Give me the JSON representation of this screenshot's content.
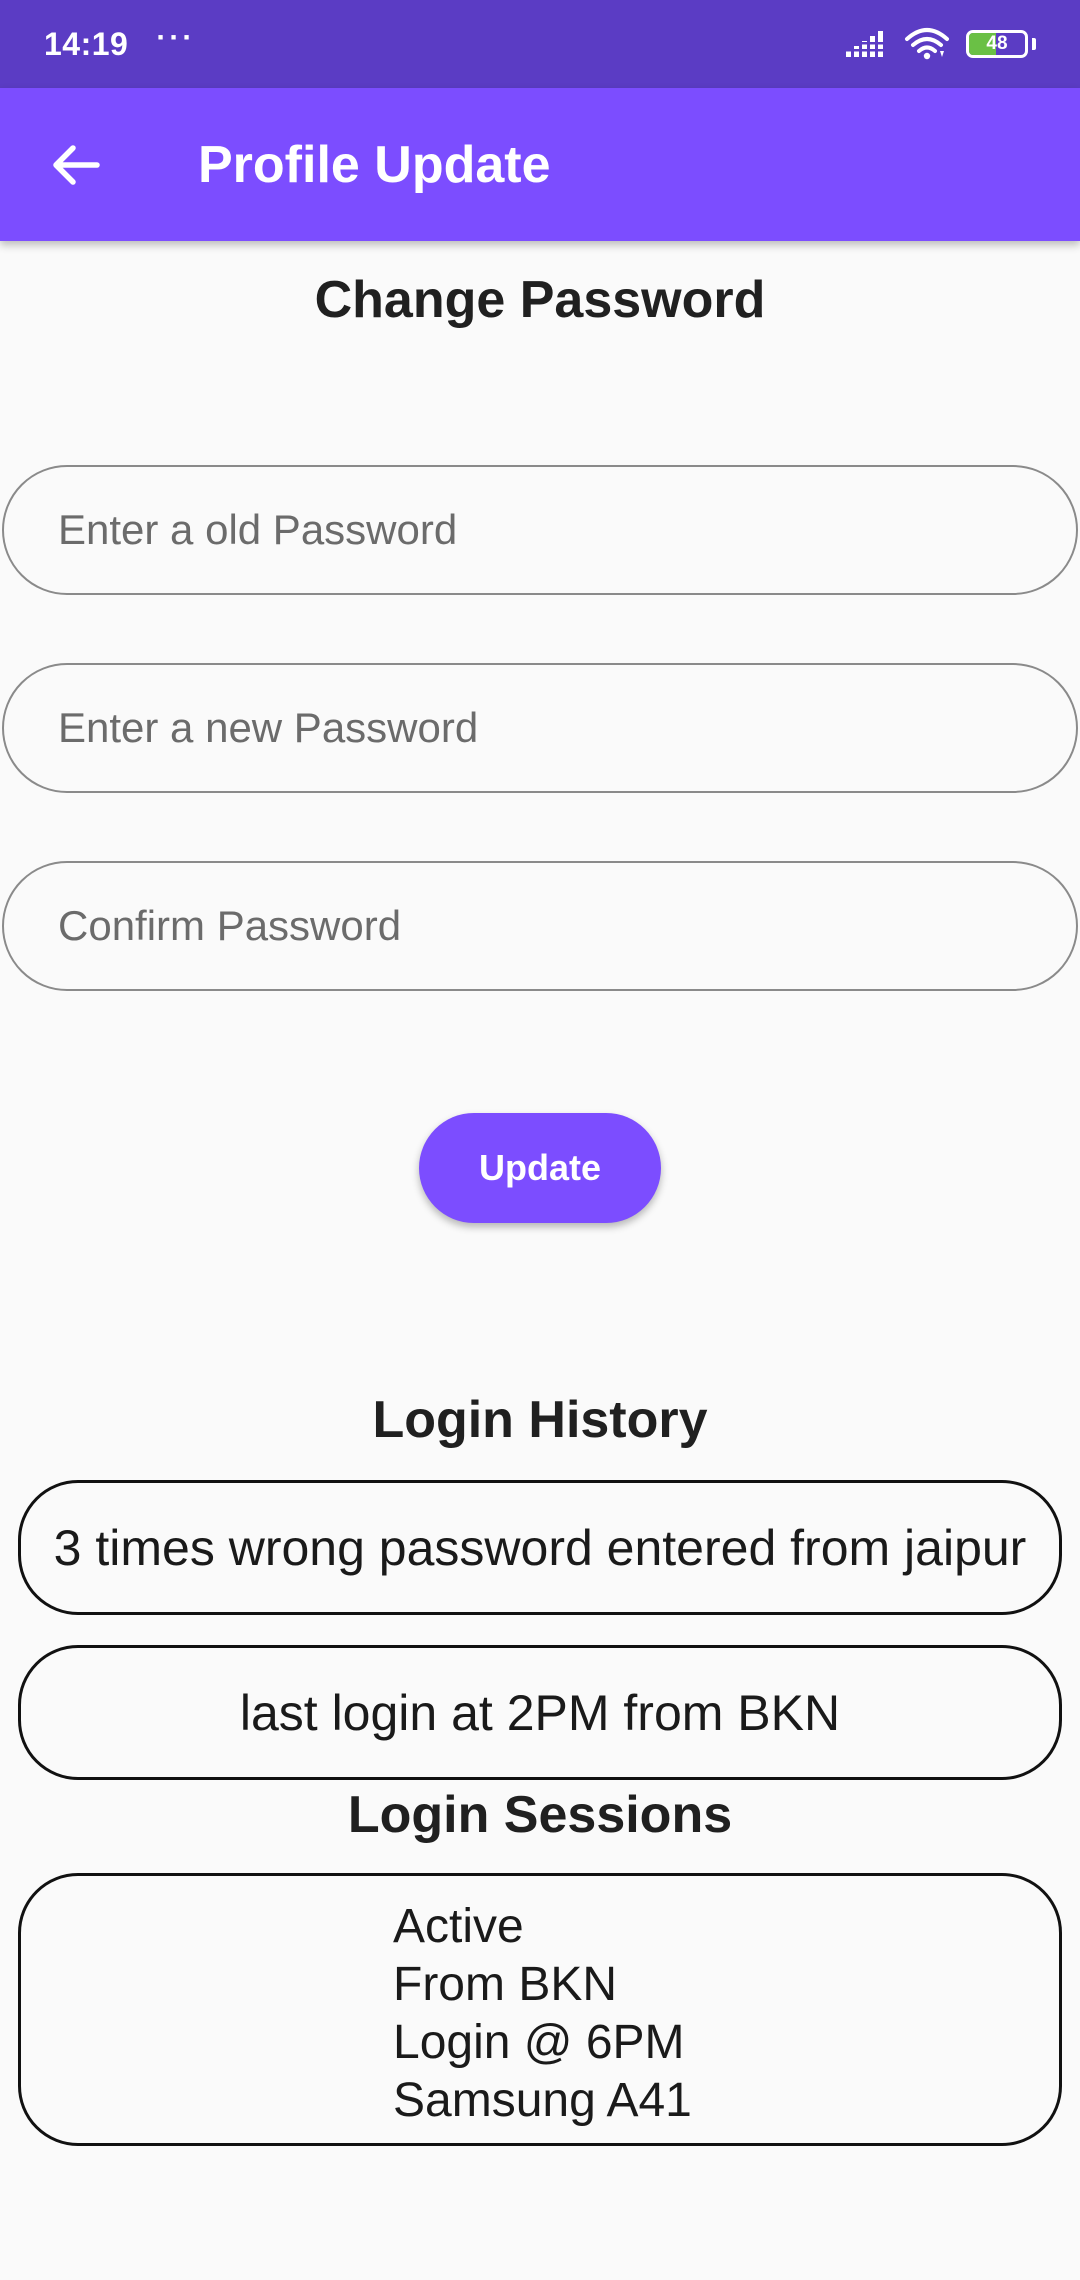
{
  "status_bar": {
    "time": "14:19",
    "dots": "···",
    "battery_level": "48",
    "battery_fraction": 0.48
  },
  "app_bar": {
    "title": "Profile Update",
    "back_icon": "arrow-left-icon",
    "color": "#7c4dff"
  },
  "change_password": {
    "title": "Change Password",
    "old_password_placeholder": "Enter a old Password",
    "new_password_placeholder": "Enter a new Password",
    "confirm_password_placeholder": "Confirm Password",
    "update_label": "Update"
  },
  "login_history": {
    "title": "Login History",
    "items": [
      "3 times wrong password entered from jaipur",
      "last login at 2PM from BKN"
    ]
  },
  "login_sessions": {
    "title": "Login Sessions",
    "session": {
      "status": "Active",
      "from": "From BKN",
      "login_time": "Login @ 6PM",
      "device": "Samsung A41"
    }
  }
}
